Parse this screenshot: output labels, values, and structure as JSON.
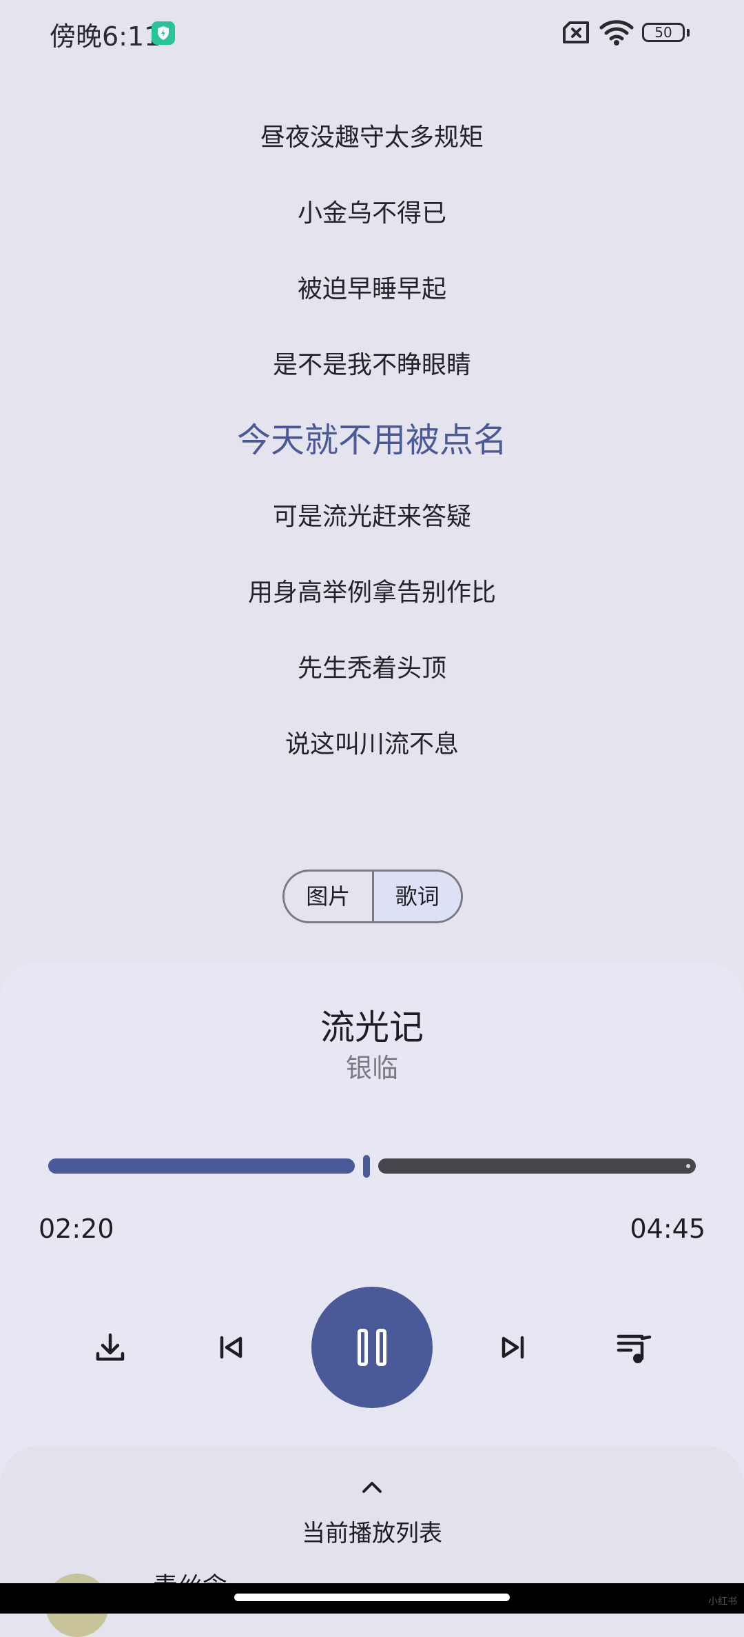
{
  "status_bar": {
    "time": "傍晚6:11",
    "battery": "50",
    "icons": [
      "shield-icon",
      "sim-off-icon",
      "wifi-icon",
      "battery-icon"
    ]
  },
  "lyrics": [
    {
      "text": "昼夜没趣守太多规矩",
      "active": false
    },
    {
      "text": "小金乌不得已",
      "active": false
    },
    {
      "text": "被迫早睡早起",
      "active": false
    },
    {
      "text": "是不是我不睁眼睛",
      "active": false
    },
    {
      "text": "今天就不用被点名",
      "active": true
    },
    {
      "text": "可是流光赶来答疑",
      "active": false
    },
    {
      "text": "用身高举例拿告别作比",
      "active": false
    },
    {
      "text": "先生秃着头顶",
      "active": false
    },
    {
      "text": "说这叫川流不息",
      "active": false
    }
  ],
  "view_toggle": {
    "options": [
      "图片",
      "歌词"
    ],
    "selected": "歌词"
  },
  "now_playing": {
    "title": "流光记",
    "artist": "银临",
    "current_time": "02:20",
    "total_time": "04:45",
    "progress_fraction": 0.491
  },
  "controls": {
    "icons": [
      "download-icon",
      "previous-icon",
      "pause-icon",
      "next-icon",
      "playlist-icon"
    ]
  },
  "queue_sheet": {
    "label": "当前播放列表",
    "next_title_partial": "青丝念"
  },
  "colors": {
    "accent": "#4a5a98",
    "background": "#e5e4ee",
    "panel": "#e7e7f4",
    "toggle_selected": "#dde1f7"
  },
  "watermark": "小红书"
}
